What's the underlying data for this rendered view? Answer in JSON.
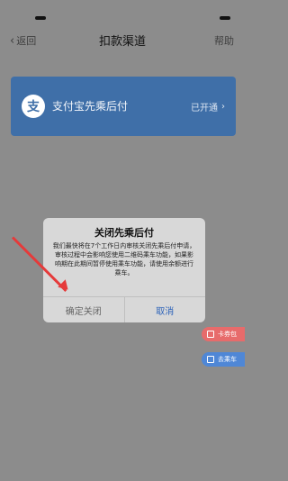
{
  "status_bar": {},
  "nav": {
    "back_label": "返回",
    "title": "扣款渠道",
    "help_label": "帮助"
  },
  "payment_card": {
    "logo_text": "支",
    "name": "支付宝先乘后付",
    "status_text": "已开通"
  },
  "dialog": {
    "title": "关闭先乘后付",
    "body": "我们最快将在7个工作日内审核关闭先乘后付申请，审核过程中会影响您使用二维码乘车功能，如果影响期在此期间暂停使用乘车功能，请使用余额进行乘车。",
    "confirm_label": "确定关闭",
    "cancel_label": "取消"
  },
  "floating": {
    "card_pack_label": "卡券包",
    "ride_label": "去乘车"
  },
  "colors": {
    "overlay": "#8c8c8c",
    "card_bg": "#3f6fa8",
    "cancel_text": "#2b61b8",
    "arrow": "#e53a3a"
  }
}
